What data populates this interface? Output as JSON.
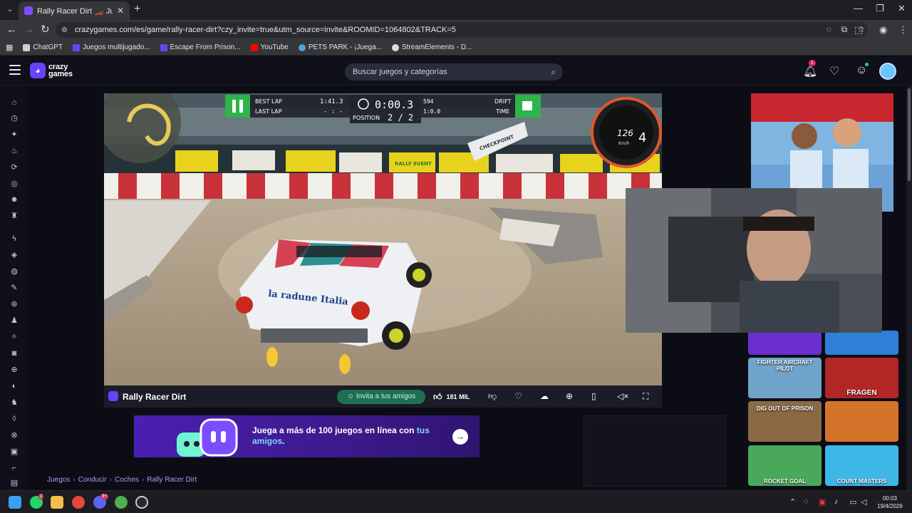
{
  "browser": {
    "tab_title": "Rally Racer Dirt 🏎️ Juega en Cr",
    "url": "crazygames.com/es/game/rally-racer-dirt?czy_invite=true&utm_source=invite&ROOMID=1064802&TRACK=5",
    "bookmarks": [
      {
        "label": "ChatGPT",
        "color": "#cfcfcf"
      },
      {
        "label": "Juegos multijugado...",
        "color": "#6842ff"
      },
      {
        "label": "Escape From Prison...",
        "color": "#6842ff"
      },
      {
        "label": "YouTube",
        "color": "#ff0000"
      },
      {
        "label": "PETS PARK - ¡Juega...",
        "color": "#4aa3df"
      },
      {
        "label": "StreamElements - D...",
        "color": "#dddddd"
      }
    ]
  },
  "site": {
    "logo_line1": "crazy",
    "logo_line2": "games",
    "search_placeholder": "Buscar juegos y categorías",
    "notification_count": "1",
    "accent": "#6842ff"
  },
  "game": {
    "title": "Rally Racer Dirt",
    "invite_label": "Invita a tus amigos",
    "likes": "181 MIL",
    "hud": {
      "best_lap_label": "BEST LAP",
      "last_lap_label": "LAST LAP",
      "best_lap": "1:41.3",
      "last_lap": "- : -",
      "timer": "0:00.3",
      "position_label": "POSITION",
      "position": "2 / 2",
      "drift_score": "594",
      "drift_time_value": "1:0.0",
      "drift_label": "DRIFT",
      "time_label": "TIME",
      "speed": "126",
      "speed_unit": "Km/h",
      "gear": "4",
      "car_text": "la radune Italia",
      "banner_text": "RALLY EVENT",
      "checkpoint_text": "CHECKPOINT"
    }
  },
  "promo": {
    "text_main": "Juega a más de 100 juegos en línea con ",
    "text_highlight": "tus amigos",
    "text_end": "."
  },
  "breadcrumb": [
    "Juegos",
    "Conducir",
    "Coches",
    "Rally Racer Dirt"
  ],
  "thumbnails": [
    {
      "label": "",
      "color": "#6b2fd0"
    },
    {
      "label": "",
      "color": "#2f7fd8"
    },
    {
      "label": "FIGHTER AIRCRAFT PILOT",
      "color": "#6fa3c9"
    },
    {
      "label": "FRAGEN",
      "color": "#b32626"
    },
    {
      "label": "DIG OUT OF PRISON",
      "color": "#8a6a45"
    },
    {
      "label": "",
      "color": "#d6732a"
    },
    {
      "label": "ROCKET GOAL",
      "color": "#4aa85a"
    },
    {
      "label": "COUNT MASTERS",
      "color": "#3db7e6"
    }
  ],
  "taskbar": {
    "time": "00:03",
    "date": "19/4/2026",
    "whatsapp_badge": "2",
    "discord_badge": "9+"
  }
}
